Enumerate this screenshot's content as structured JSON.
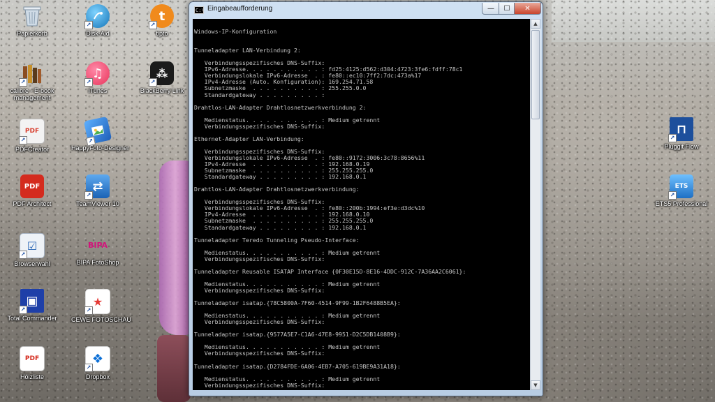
{
  "desktop": {
    "icons": [
      {
        "label": "Papierkorb",
        "icon": "recycle-bin-icon",
        "color": "#9fb6c8"
      },
      {
        "label": "Disk-Aid",
        "icon": "disk-aid-icon",
        "color": "#2a9fd6"
      },
      {
        "label": "tipto",
        "icon": "tipto-icon",
        "color": "#f08a1c",
        "glyph": "t"
      },
      {
        "label": "calibre - E-book management",
        "icon": "calibre-books-icon",
        "color": "#7a5a33"
      },
      {
        "label": "iTunes",
        "icon": "itunes-icon",
        "color": "#e8335a",
        "glyph": "♫"
      },
      {
        "label": "BlackBerry Link",
        "icon": "blackberry-icon",
        "color": "#1b1b1b",
        "glyph": "⁂"
      },
      {
        "label": "PDFCreator",
        "icon": "pdfcreator-icon",
        "color": "#d94030",
        "glyph": "PDF"
      },
      {
        "label": "HappyFoto-Designer",
        "icon": "happyfoto-icon",
        "color": "#2f7bd8"
      },
      {
        "label": "PDF Architect",
        "icon": "pdf-architect-icon",
        "color": "#d42b1e",
        "glyph": "PDF"
      },
      {
        "label": "TeamViewer 10",
        "icon": "teamviewer-icon",
        "color": "#1a73c9",
        "glyph": "⇄"
      },
      {
        "label": "Browserwahl",
        "icon": "browserwahl-icon",
        "color": "#e9eef5",
        "glyph": "☑"
      },
      {
        "label": "BIPA FotoShop",
        "icon": "bipa-icon",
        "color": "#d2147b",
        "glyph": "BIPA"
      },
      {
        "label": "Total Commander",
        "icon": "total-commander-icon",
        "color": "#1e3fa8",
        "glyph": "▣"
      },
      {
        "label": "CEWE FOTOSCHAU",
        "icon": "cewe-icon",
        "color": "#ffffff",
        "glyph": "★"
      },
      {
        "label": "Hölzliste",
        "icon": "pdf-file-icon",
        "color": "#d42b1e",
        "glyph": "PDF"
      },
      {
        "label": "Dropbox",
        "icon": "dropbox-icon",
        "color": "#ffffff",
        "glyph": "❖"
      },
      {
        "label": "Pluggit Flow",
        "icon": "pluggit-icon",
        "color": "#1d4f9c",
        "glyph": "⊓"
      },
      {
        "label": "ETS5 Professional",
        "icon": "ets5-icon",
        "color": "#2a8ee0",
        "glyph": "ETS"
      }
    ]
  },
  "window": {
    "title": "Eingabeaufforderung",
    "icon_label": "C:\\",
    "minimize": "—",
    "maximize": "☐",
    "close": "✕",
    "scroll_up": "▲",
    "scroll_down": "▼",
    "lines": [
      "",
      "Windows-IP-Konfiguration",
      "",
      "",
      "Tunneladapter LAN-Verbindung 2:",
      "",
      "   Verbindungsspezifisches DNS-Suffix:",
      "   IPv6-Adresse. . . . . . . . . . . : fd25:4125:d562:d304:4723:3fe6:fdff:78c1",
      "   Verbindungslokale IPv6-Adresse  . : fe80::ec10:7ff2:7dc:473a%17",
      "   IPv4-Adresse (Auto. Konfiguration): 169.254.71.58",
      "   Subnetzmaske  . . . . . . . . . . : 255.255.0.0",
      "   Standardgateway . . . . . . . . . :",
      "",
      "Drahtlos-LAN-Adapter Drahtlosnetzwerkverbindung 2:",
      "",
      "   Medienstatus. . . . . . . . . . . : Medium getrennt",
      "   Verbindungsspezifisches DNS-Suffix:",
      "",
      "Ethernet-Adapter LAN-Verbindung:",
      "",
      "   Verbindungsspezifisches DNS-Suffix:",
      "   Verbindungslokale IPv6-Adresse  . : fe80::9172:3006:3c78:8656%11",
      "   IPv4-Adresse  . . . . . . . . . . : 192.168.0.19",
      "   Subnetzmaske  . . . . . . . . . . : 255.255.255.0",
      "   Standardgateway . . . . . . . . . : 192.168.0.1",
      "",
      "Drahtlos-LAN-Adapter Drahtlosnetzwerkverbindung:",
      "",
      "   Verbindungsspezifisches DNS-Suffix:",
      "   Verbindungslokale IPv6-Adresse  . : fe80::200b:1994:ef3e:d3dc%10",
      "   IPv4-Adresse  . . . . . . . . . . : 192.168.0.10",
      "   Subnetzmaske  . . . . . . . . . . : 255.255.255.0",
      "   Standardgateway . . . . . . . . . : 192.168.0.1",
      "",
      "Tunneladapter Teredo Tunneling Pseudo-Interface:",
      "",
      "   Medienstatus. . . . . . . . . . . : Medium getrennt",
      "   Verbindungsspezifisches DNS-Suffix:",
      "",
      "Tunneladapter Reusable ISATAP Interface {0F30E15D-8E16-4DDC-912C-7A36AA2C6061}:",
      "",
      "   Medienstatus. . . . . . . . . . . : Medium getrennt",
      "   Verbindungsspezifisches DNS-Suffix:",
      "",
      "Tunneladapter isatap.{78C5800A-7F60-4514-9F99-1B2F6488B5EA}:",
      "",
      "   Medienstatus. . . . . . . . . . . : Medium getrennt",
      "   Verbindungsspezifisches DNS-Suffix:",
      "",
      "Tunneladapter isatap.{9577A5E7-C1A6-47E8-9951-D2C5DB1408B9}:",
      "",
      "   Medienstatus. . . . . . . . . . . : Medium getrennt",
      "   Verbindungsspezifisches DNS-Suffix:",
      "",
      "Tunneladapter isatap.{D2784FDE-6A06-4EB7-A705-619BE9A31A18}:",
      "",
      "   Medienstatus. . . . . . . . . . . : Medium getrennt",
      "   Verbindungsspezifisches DNS-Suffix:"
    ]
  }
}
